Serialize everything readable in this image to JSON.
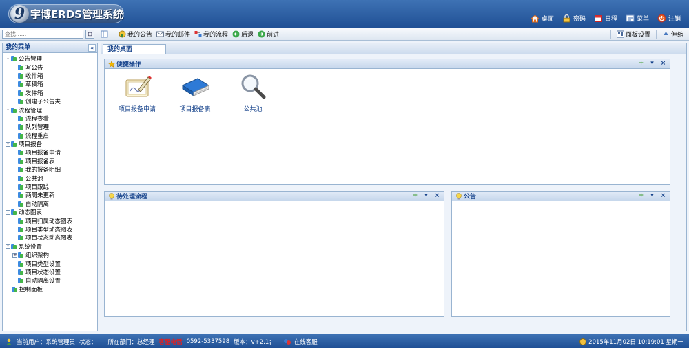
{
  "header": {
    "logo_mark": "9",
    "title": "宇博ERDS管理系统",
    "nav": [
      {
        "label": "桌面",
        "icon": "home-icon"
      },
      {
        "label": "密码",
        "icon": "lock-icon"
      },
      {
        "label": "日程",
        "icon": "calendar-icon"
      },
      {
        "label": "菜单",
        "icon": "menu-icon"
      },
      {
        "label": "注销",
        "icon": "logout-icon"
      }
    ]
  },
  "toolbar": {
    "search_placeholder": "查找......",
    "search_button": "⊡",
    "left_items": [
      {
        "label": "我的公告",
        "icon": "bulletin-icon"
      },
      {
        "label": "我的邮件",
        "icon": "mail-icon"
      },
      {
        "label": "我的流程",
        "icon": "workflow-icon"
      },
      {
        "label": "后退",
        "icon": "back-icon"
      },
      {
        "label": "前进",
        "icon": "forward-icon"
      }
    ],
    "right_items": [
      {
        "label": "面板设置",
        "icon": "panel-settings-icon"
      },
      {
        "label": "伸缩",
        "icon": "expand-icon"
      }
    ]
  },
  "sidebar": {
    "title": "我的菜单",
    "collapse": "«",
    "tree": [
      {
        "label": "公告管理",
        "level": 0,
        "toggle": "-"
      },
      {
        "label": "写公告",
        "level": 1
      },
      {
        "label": "收件箱",
        "level": 1
      },
      {
        "label": "草稿箱",
        "level": 1
      },
      {
        "label": "发件箱",
        "level": 1
      },
      {
        "label": "创建子公告夹",
        "level": 1
      },
      {
        "label": "流程管理",
        "level": 0,
        "toggle": "-"
      },
      {
        "label": "流程查看",
        "level": 1
      },
      {
        "label": "队列管理",
        "level": 1
      },
      {
        "label": "流程重启",
        "level": 1
      },
      {
        "label": "项目报备",
        "level": 0,
        "toggle": "-"
      },
      {
        "label": "项目报备申请",
        "level": 1
      },
      {
        "label": "项目报备表",
        "level": 1
      },
      {
        "label": "我的报备明细",
        "level": 1
      },
      {
        "label": "公共池",
        "level": 1
      },
      {
        "label": "项目跟踪",
        "level": 1
      },
      {
        "label": "两周未更新",
        "level": 1
      },
      {
        "label": "自动隔离",
        "level": 1
      },
      {
        "label": "动态图表",
        "level": 0,
        "toggle": "-"
      },
      {
        "label": "项目归属动态图表",
        "level": 1
      },
      {
        "label": "项目类型动态图表",
        "level": 1
      },
      {
        "label": "项目状态动态图表",
        "level": 1
      },
      {
        "label": "系统设置",
        "level": 0,
        "toggle": "-"
      },
      {
        "label": "组织架构",
        "level": 1,
        "toggle": "+"
      },
      {
        "label": "项目类型设置",
        "level": 1
      },
      {
        "label": "项目状态设置",
        "level": 1
      },
      {
        "label": "自动隔离设置",
        "level": 1
      },
      {
        "label": "控制面板",
        "level": 0
      }
    ]
  },
  "main": {
    "tab": "我的桌面",
    "tools": {
      "add": "+",
      "down": "▾",
      "close": "×"
    },
    "quick": {
      "title": "便捷操作",
      "items": [
        {
          "label": "项目报备申请",
          "icon": "document-edit-icon"
        },
        {
          "label": "项目报备表",
          "icon": "book-icon"
        },
        {
          "label": "公共池",
          "icon": "magnifier-icon"
        }
      ]
    },
    "pending": {
      "title": "待处理流程"
    },
    "notice": {
      "title": "公告"
    }
  },
  "status": {
    "user_label": "当前用户：系统管理员",
    "state_label": "状态：",
    "dept_label": "所在部门：总经理",
    "hotline_label": "客服电话",
    "hotline": "0592-5337598",
    "version": "版本：v+2.1；",
    "online_service": "在线客服",
    "datetime": "2015年11月02日  10:19:01  星期一"
  },
  "colors": {
    "header": "#2b5ea3",
    "panel_border": "#99b4d1",
    "title_text": "#15428b",
    "hotline": "#e02020"
  }
}
